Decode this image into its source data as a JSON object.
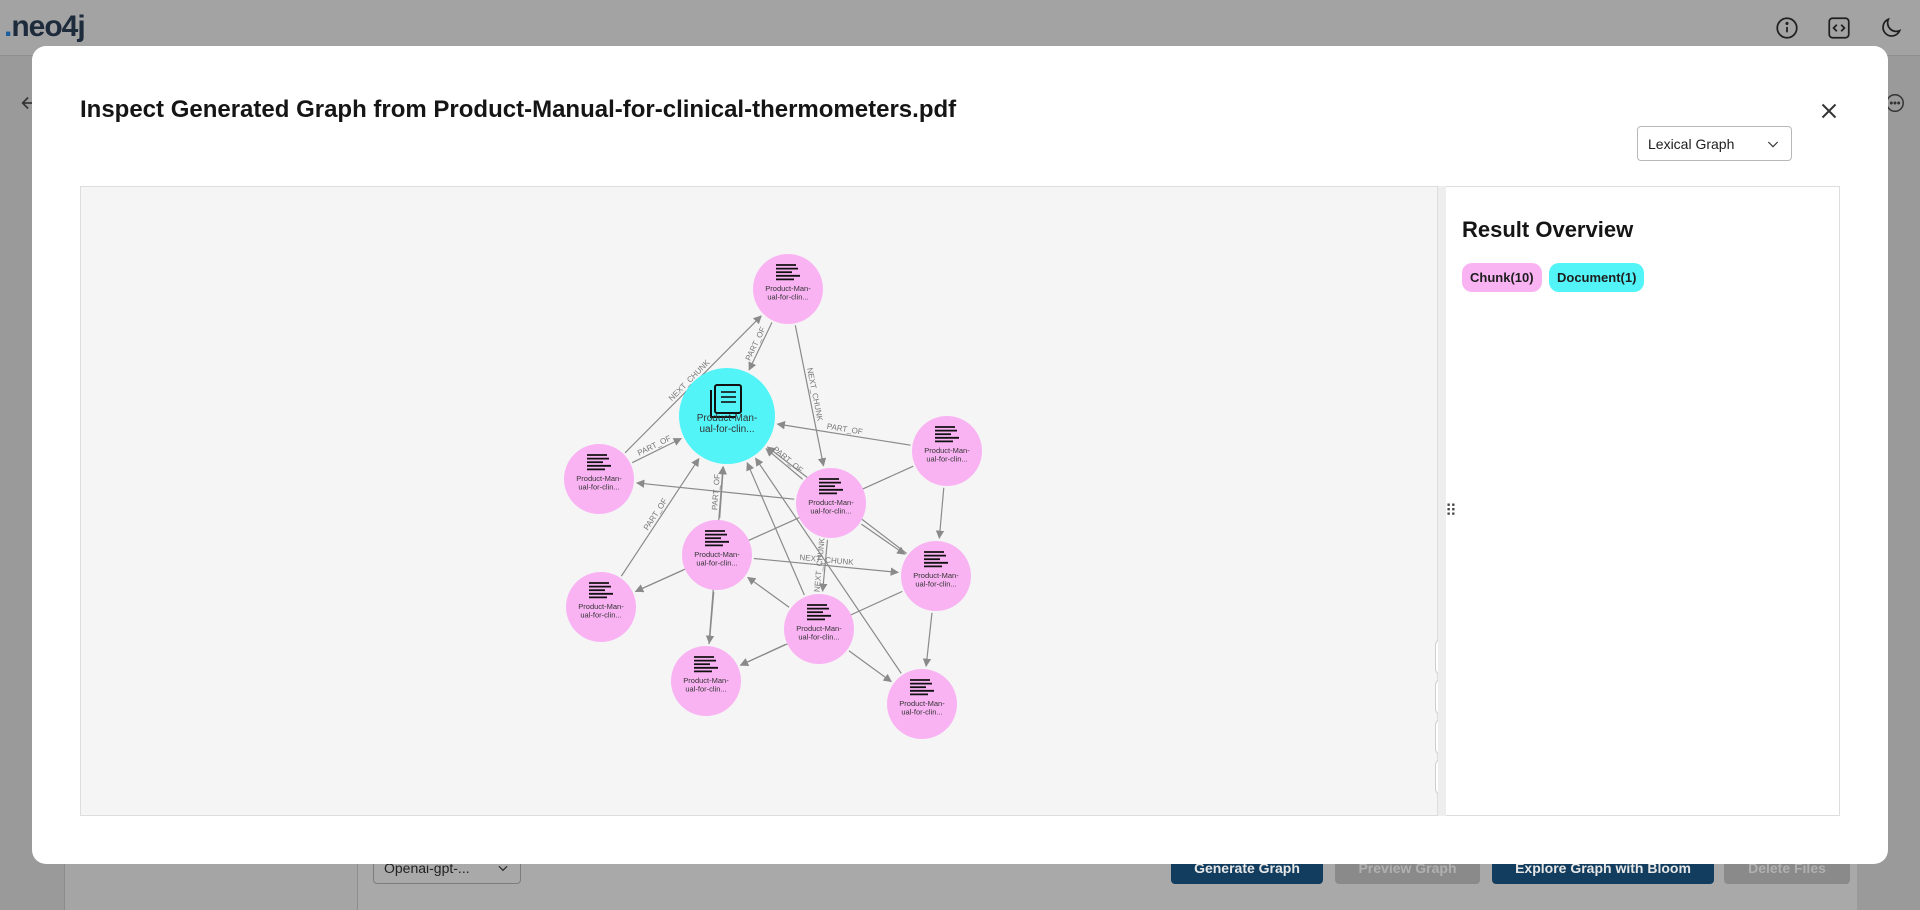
{
  "app": {
    "logo_text": "neo4j"
  },
  "background": {
    "model_select": "Openai-gpt-...",
    "buttons": {
      "generate": "Generate Graph",
      "preview": "Preview Graph",
      "bloom": "Explore Graph with Bloom",
      "delete": "Delete Files"
    }
  },
  "modal": {
    "title": "Inspect Generated Graph from Product-Manual-for-clinical-thermometers.pdf",
    "view_select": "Lexical Graph"
  },
  "graph": {
    "node_label_line1": "Product-Man-",
    "node_label_line2": "ual-for-clin...",
    "edge_labels": {
      "part_of": "PART_OF",
      "next_chunk": "NEXT_CHUNK"
    },
    "colors": {
      "chunk": "#f9b3f3",
      "document": "#52f4f7",
      "edge": "#8a8a8a"
    }
  },
  "overview": {
    "title": "Result Overview",
    "chips": {
      "chunk": "Chunk(10)",
      "document": "Document(1)"
    }
  },
  "icons": [
    "info-icon",
    "code-icon",
    "moon-icon",
    "close-icon",
    "chevron-down-icon",
    "refresh-icon",
    "zoom-in-icon",
    "zoom-out-icon",
    "fit-screen-icon",
    "document-icon",
    "text-lines-icon"
  ]
}
